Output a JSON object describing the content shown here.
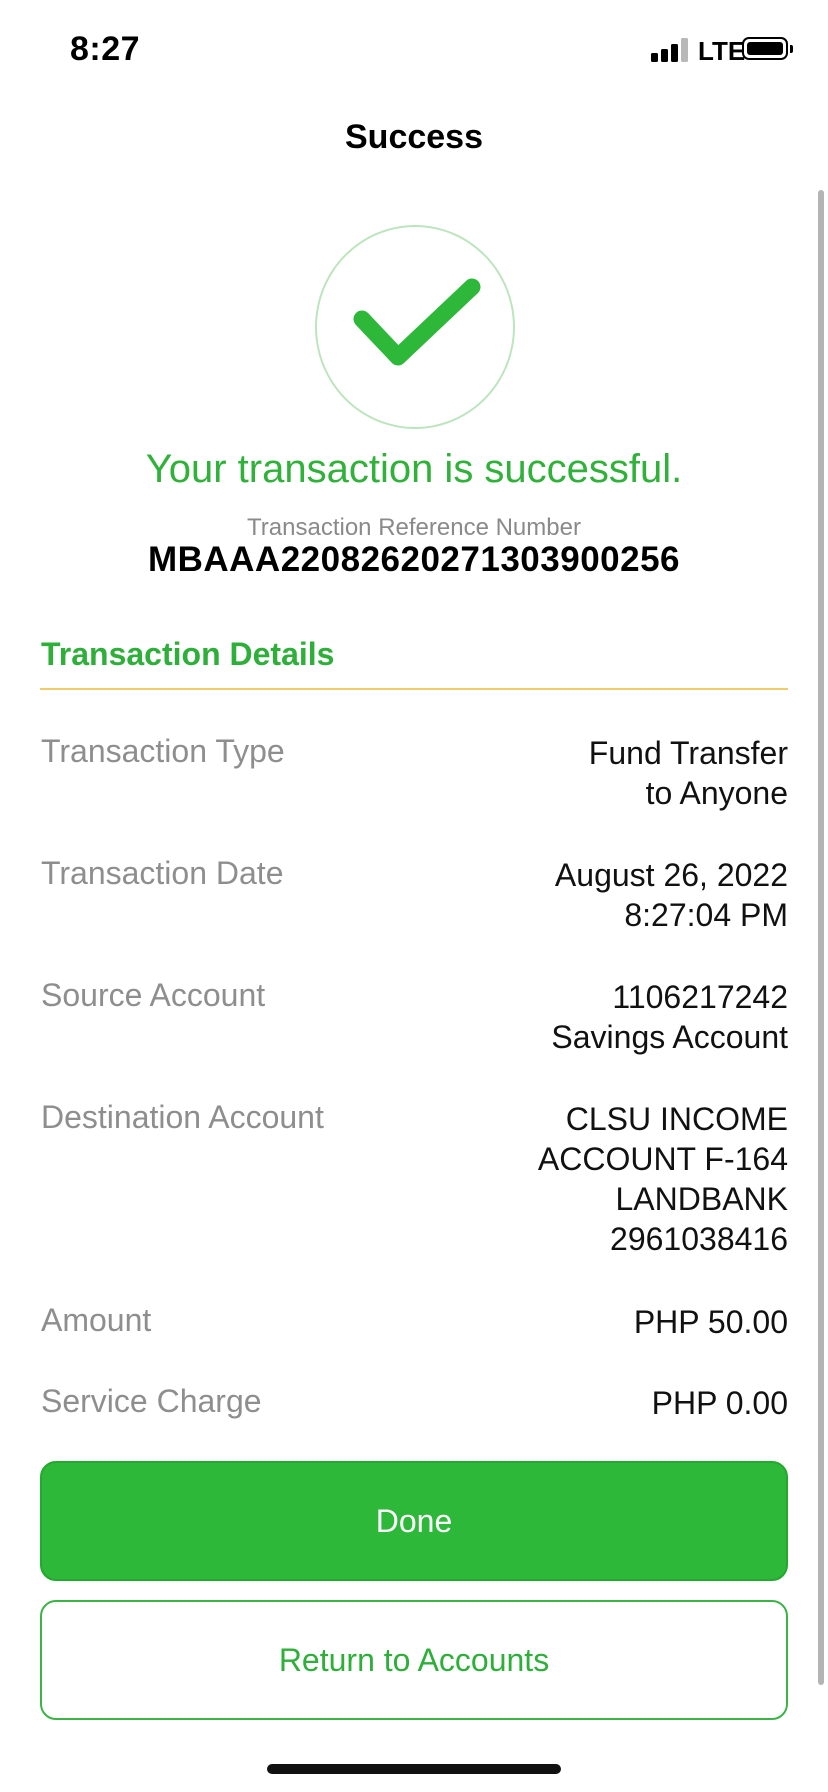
{
  "status_bar": {
    "time": "8:27",
    "network": "LTE",
    "icons": [
      "signal-icon",
      "battery-icon"
    ]
  },
  "nav": {
    "title": "Success"
  },
  "result": {
    "icon": "checkmark-icon",
    "message": "Your transaction is successful.",
    "reference_label": "Transaction Reference Number",
    "reference_number": "MBAAA22082620271303900256"
  },
  "details": {
    "title": "Transaction Details",
    "rows": [
      {
        "label": "Transaction Type",
        "value_lines": [
          "Fund Transfer",
          "to Anyone"
        ]
      },
      {
        "label": "Transaction Date",
        "value_lines": [
          "August 26, 2022",
          "8:27:04 PM"
        ]
      },
      {
        "label": "Source Account",
        "value_lines": [
          "1106217242",
          "Savings Account"
        ]
      },
      {
        "label": "Destination Account",
        "value_lines": [
          "CLSU INCOME",
          "ACCOUNT F-164",
          "LANDBANK",
          "2961038416"
        ]
      },
      {
        "label": "Amount",
        "value_lines": [
          "PHP 50.00"
        ]
      },
      {
        "label": "Service Charge",
        "value_lines": [
          "PHP 0.00"
        ]
      }
    ]
  },
  "actions": {
    "done_label": "Done",
    "return_label": "Return to Accounts"
  },
  "colors": {
    "accent_green": "#2db83a",
    "text_green": "#30b13a",
    "divider": "#f2cc6a",
    "muted_text": "#8e8e8e"
  }
}
